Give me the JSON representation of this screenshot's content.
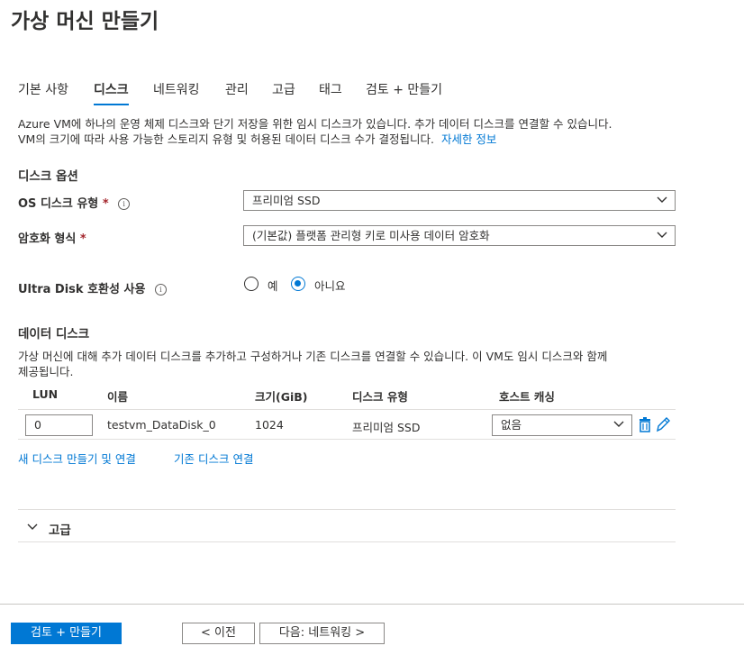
{
  "page": {
    "title": "가상 머신 만들기",
    "tabs": [
      "기본 사항",
      "디스크",
      "네트워킹",
      "관리",
      "고급",
      "태그",
      "검토 + 만들기"
    ],
    "active_tab": "디스크"
  },
  "intro": {
    "line1": "Azure VM에 하나의 운영 체제 디스크와 단기 저장을 위한 임시 디스크가 있습니다. 추가 데이터 디스크를 연결할 수 있습니다.",
    "line2": "VM의 크기에 따라 사용 가능한 스토리지 유형 및 허용된 데이터 디스크 수가 결정됩니다.",
    "learn_more": "자세한 정보"
  },
  "disk_options": {
    "heading": "디스크 옵션",
    "os_disk_type_label": "OS 디스크 유형",
    "os_disk_type_value": "프리미엄 SSD",
    "encryption_label": "암호화 형식",
    "encryption_value": "(기본값) 플랫폼 관리형 키로 미사용 데이터 암호화",
    "ultra_disk_label": "Ultra Disk 호환성 사용",
    "ultra_yes": "예",
    "ultra_no": "아니요",
    "ultra_selected": "아니요",
    "required_mark": "*"
  },
  "data_disks": {
    "heading": "데이터 디스크",
    "description_line1": "가상 머신에 대해 추가 데이터 디스크를 추가하고 구성하거나 기존 디스크를 연결할 수 있습니다. 이 VM도 임시 디스크와 함께",
    "description_line2": "제공됩니다.",
    "columns": [
      "LUN",
      "이름",
      "크기(GiB)",
      "디스크 유형",
      "호스트 캐싱"
    ],
    "rows": [
      {
        "lun": "0",
        "name": "testvm_DataDisk_0",
        "size": "1024",
        "type": "프리미엄 SSD",
        "caching": "없음"
      }
    ],
    "create_attach": "새 디스크 만들기 및 연결",
    "attach_existing": "기존 디스크 연결"
  },
  "advanced": {
    "label": "고급"
  },
  "footer": {
    "review_create": "검토 + 만들기",
    "previous": "< 이전",
    "next": "다음: 네트워킹 >"
  },
  "colors": {
    "accent": "#0078d4",
    "required": "#a4262c",
    "border": "#8a8886",
    "divider": "#e1dfdd"
  }
}
